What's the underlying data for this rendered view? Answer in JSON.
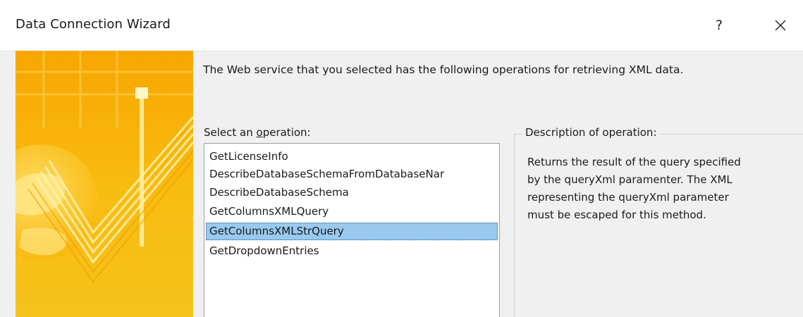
{
  "window": {
    "title": "Data Connection Wizard",
    "help_glyph": "?",
    "close_icon": "close-icon"
  },
  "intro_text": "The Web service that you selected has the following operations for retrieving XML data.",
  "operation_select": {
    "label_before": "Select an ",
    "label_accel": "o",
    "label_after": "peration:",
    "items": [
      {
        "label": "GetLicenseInfo"
      },
      {
        "label": "DescribeDatabaseSchemaFromDatabaseNar"
      },
      {
        "label": "DescribeDatabaseSchema"
      },
      {
        "label": "GetColumnsXMLQuery"
      },
      {
        "label": "GetColumnsXMLStrQuery"
      },
      {
        "label": "GetDropdownEntries"
      }
    ],
    "selected_label": "GetColumnsXMLStrQuery"
  },
  "description": {
    "legend": "Description of operation:",
    "lines": [
      "Returns the result of the query specified",
      "by the queryXml paramenter.  The XML",
      "representing the queryXml parameter",
      "must be escaped for this method."
    ]
  },
  "colors": {
    "accent_yellow": "#f4b400",
    "selection": "#99c9ef",
    "dialog_bg": "#f0f0f0"
  }
}
